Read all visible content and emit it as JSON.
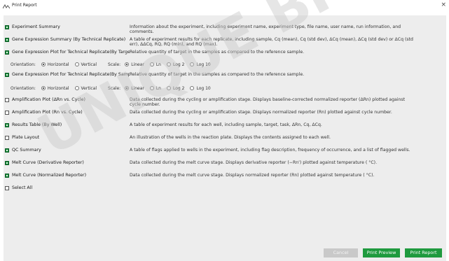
{
  "window": {
    "title": "Print Report",
    "close_glyph": "×",
    "icon": "app-logo-icon"
  },
  "options": [
    {
      "label": "Experiment Summary",
      "checked": true,
      "desc": "Information about the experiment, including experiment name, experiment type, file name, user name, run information, and comments."
    },
    {
      "label": "Gene Expression Summary (By Technical Replicate)",
      "checked": true,
      "desc": "A table of experiment results for each replicate, including sample, Cq (mean), Cq (std dev), ΔCq (mean), ΔCq (std dev) or ΔCq (std err), ΔΔCq, RQ, RQ (min), and RQ (max)."
    },
    {
      "label": "Gene Expression Plot for Technical Replicate(By Target)",
      "checked": true,
      "desc": "Relative quantity of target in the samples as compared to the reference sample."
    },
    {
      "label": "Gene Expression Plot for Technical Replicate(By Sample)",
      "checked": true,
      "desc": "Relative quantity of target in the samples as compared to the reference sample."
    },
    {
      "label": "Amplification Plot (ΔRn vs. Cycle)",
      "checked": false,
      "desc": "Data collected during the cycling or amplification stage. Displays baseline-corrected normalized reporter (ΔRn) plotted against cycle number."
    },
    {
      "label": "Amplification Plot (Rn vs. Cycle)",
      "checked": false,
      "desc": "Data collected during the cycling or amplification stage. Displays normalized reporter (Rn) plotted against cycle number."
    },
    {
      "label": "Results Table (By Well)",
      "checked": true,
      "desc": "A table of experiment results for each well, including sample, target, task, ΔRn, Cq, ΔCq."
    },
    {
      "label": "Plate Layout",
      "checked": false,
      "desc": "An illustration of the wells in the reaction plate. Displays the contents assigned to each well."
    },
    {
      "label": "QC Summary",
      "checked": true,
      "desc": "A table of flags applied to wells in the experiment, including flag description, frequency of occurrence, and a list of flagged wells."
    },
    {
      "label": "Melt Curve (Derivative Reporter)",
      "checked": true,
      "desc": "Data collected during the melt curve stage. Displays derivative reporter (−Rn') plotted against temperature ( °C)."
    },
    {
      "label": "Melt Curve (Normalized Reporter)",
      "checked": true,
      "desc": "Data collected during the melt curve stage. Displays normalized reporter (Rn) plotted against temperature ( °C)."
    },
    {
      "label": "Select All",
      "checked": false,
      "desc": ""
    }
  ],
  "plot_settings": {
    "orientation_label": "Orientation:",
    "scale_label": "Scale:",
    "orientations": [
      "Horizontal",
      "Vertical"
    ],
    "scales": [
      "Linear",
      "Ln",
      "Log 2",
      "Log 10"
    ],
    "by_target": {
      "orientation": "Horizontal",
      "scale": "Linear"
    },
    "by_sample": {
      "orientation": "Horizontal",
      "scale": "Linear"
    }
  },
  "buttons": {
    "cancel": "Cancel",
    "preview": "Print Preview",
    "print": "Print Report"
  },
  "colors": {
    "accent": "#1f9a3e",
    "disabled": "#c9c9c9",
    "panel": "#ededed"
  },
  "watermark": "UNIQUE BIO"
}
